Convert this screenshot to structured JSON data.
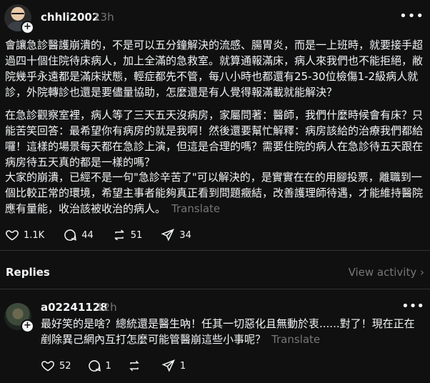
{
  "post": {
    "username": "chhli2002",
    "timestamp": "13h",
    "paragraphs": [
      "會讓急診醫護崩潰的，不是可以五分鐘解決的流感、腸胃炎，而是一上班時，就要接手超過四十個住院待床病人，加上全滿的急救室。就算通報滿床，病人來我們也不能拒絕，敝院幾乎永遠都是滿床狀態，輕症都先不管，每八小時也都還有25-30位檢傷1-2級病人就診，外院轉診也還是要儘量協助，怎麼還是有人覺得報滿載就能解決？",
      "在急診觀察室裡，病人等了三天五天沒病房，家屬問著：醫師，我們什麼時候會有床？只能苦笑回答：最希望你有病房的就是我啊！然後還要幫忙解釋：病房該給的治療我們都給囉！這樣的場景每天都在急診上演，但這是合理的嗎？需要住院的病人在急診待五天跟在病房待五天真的都是一樣的嗎？",
      "大家的崩潰，已經不是一句\"急診辛苦了\"可以解決的，是實實在在的用腳投票，離職到一個比較正常的環境，希望主事者能夠真正看到問題癥結，改善護理師待遇，才能維持醫院應有量能，收治該被收治的病人。"
    ],
    "translate_label": "Translate",
    "likes": "1.1K",
    "comments": "44",
    "reposts": "51",
    "shares": "34"
  },
  "replies_section": {
    "label": "Replies",
    "view_activity": "View activity"
  },
  "reply": {
    "username": "a02241128",
    "timestamp": "12h",
    "text": "最好笑的是啥？總統還是醫生吶！任其一切惡化且無動於衷......對了！現在正在剷除異己網內互打怎麼可能管醫崩這些小事呢？",
    "translate_label": "Translate",
    "likes": "52",
    "comments": "1",
    "shares": "1"
  },
  "icons": {
    "more": "more-horizontal-icon",
    "heart": "heart-icon",
    "comment": "comment-icon",
    "repost": "repost-icon",
    "share": "send-icon"
  },
  "colors": {
    "background": "#101010",
    "text": "#f3f5f7",
    "muted": "#777777",
    "divider": "#323232"
  }
}
